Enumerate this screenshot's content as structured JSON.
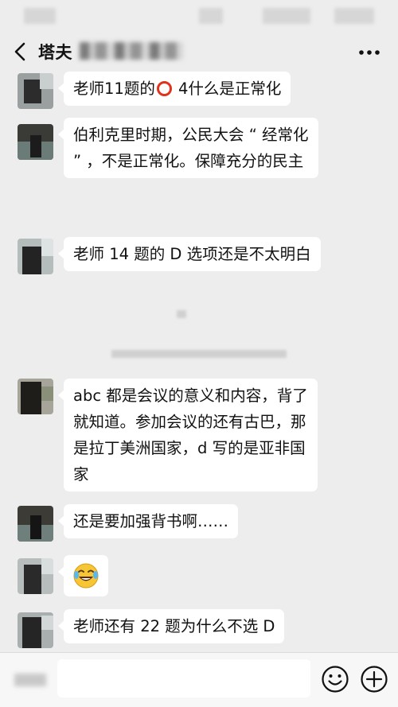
{
  "header": {
    "title": "塔夫",
    "back_icon": "chevron-left-icon",
    "more_icon": "more-icon"
  },
  "messages": [
    {
      "text_lines": [
        "老师11题的",
        " 4什么是正常化"
      ],
      "has_ring_icon": true
    },
    {
      "text_lines": [
        "伯利克里时期，公民大会 “ 经常化",
        "” ，不是正常化。保障充分的民主"
      ]
    },
    {
      "text_lines": [
        "老师 14 题的 D 选项还是不太明白"
      ]
    },
    {
      "text_lines": [
        "abc 都是会议的意义和内容，背了",
        "就知道。参加会议的还有古巴，那",
        "是拉丁美洲国家，d 写的是亚非国",
        "家"
      ]
    },
    {
      "text_lines": [
        "还是要加强背书啊……"
      ]
    },
    {
      "emoji": "laughing-tears-emoji-icon"
    },
    {
      "text_lines": [
        "老师还有 22 题为什么不选 D"
      ]
    }
  ],
  "input_bar": {
    "emoji_icon": "smile-icon",
    "plus_icon": "plus-circle-icon"
  },
  "colors": {
    "background": "#ededed",
    "bubble": "#ffffff",
    "ring": "#e0321f",
    "text": "#111111"
  }
}
